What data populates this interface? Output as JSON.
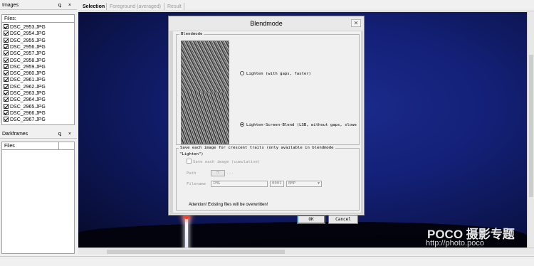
{
  "images_panel": {
    "title": "Images",
    "pin_close": "ꝗ ×",
    "files_header": "Files:",
    "files": [
      "DSC_2953.JPG",
      "DSC_2954.JPG",
      "DSC_2955.JPG",
      "DSC_2956.JPG",
      "DSC_2957.JPG",
      "DSC_2958.JPG",
      "DSC_2959.JPG",
      "DSC_2960.JPG",
      "DSC_2961.JPG",
      "DSC_2962.JPG",
      "DSC_2963.JPG",
      "DSC_2964.JPG",
      "DSC_2965.JPG",
      "DSC_2966.JPG",
      "DSC_2967.JPG"
    ]
  },
  "darkframes_panel": {
    "title": "Darkframes",
    "pin_close": "ꝗ ×",
    "files_header": "Files"
  },
  "tabs": [
    {
      "label": "Selection",
      "active": true
    },
    {
      "label": "Foreground (averaged)",
      "active": false
    },
    {
      "label": "Result",
      "active": false
    }
  ],
  "dialog": {
    "title": "Blendmode",
    "close": "✕",
    "blendmode_legend": "Blendmode",
    "options": [
      {
        "label": "Lighten (with gaps, faster)",
        "selected": false
      },
      {
        "label": "Lighten-Screen-Blend (LSB, without gaps, slowe",
        "selected": true
      }
    ],
    "save_legend": "Save each image for crescent trails (only available in blendmode",
    "save_legend_2": "\"Lighten\")",
    "save_checkbox": "Save each image (cumulative)",
    "path_label": "Path",
    "path_button": "❐",
    "path_more": "...",
    "filename_label": "Filename",
    "filename_value": "IMG",
    "counter_value": "0001",
    "format_value": "BMP",
    "attention": "Attention! Existing files will be overwritten!",
    "ok": "OK",
    "cancel": "Cancel"
  },
  "watermark": {
    "line1": "POCO 摄影专题",
    "line2": "http://photo.poco"
  }
}
